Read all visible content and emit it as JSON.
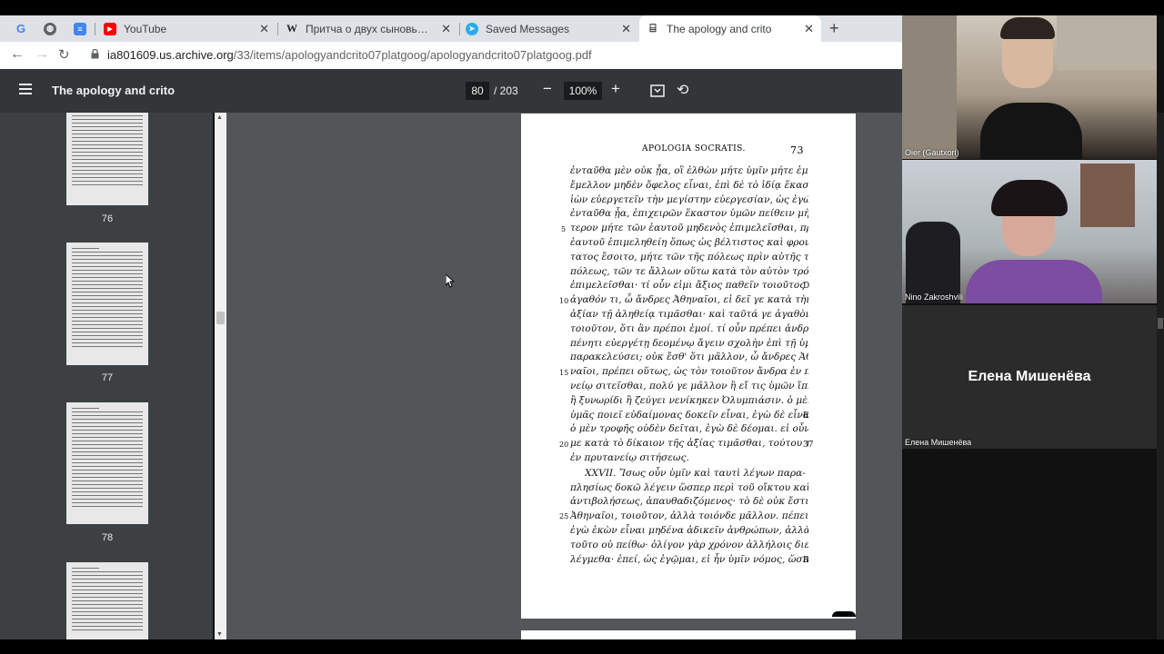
{
  "browser": {
    "tabs": [
      {
        "title": "",
        "icon": "google-icon"
      },
      {
        "title": "",
        "icon": "globe-icon"
      },
      {
        "title": "",
        "icon": "docs-icon"
      },
      {
        "title": "YouTube",
        "icon": "youtube-icon"
      },
      {
        "title": "Притча о двух сыновьях — Ви...",
        "icon": "wikipedia-icon"
      },
      {
        "title": "Saved Messages",
        "icon": "telegram-icon"
      },
      {
        "title": "The apology and crito",
        "icon": "archive-icon"
      }
    ],
    "url_host": "ia801609.us.archive.org",
    "url_path": "/33/items/apologyandcrito07platgoog/apologyandcrito07platgoog.pdf"
  },
  "pdf_toolbar": {
    "title": "The apology and crito",
    "current_page": "80",
    "total_pages": "/ 203",
    "zoom": "100%"
  },
  "thumbnails": [
    {
      "page": "76"
    },
    {
      "page": "77"
    },
    {
      "page": "78"
    }
  ],
  "document_page": {
    "running_head": "APOLOGIA SOCRATIS.",
    "page_number": "73",
    "lines": [
      "ἐνταῦθα μὲν οὐκ ᾖα, οἳ ἐλθὼν μήτε ὑμῖν μήτε ἐμαυτῷ",
      "ἔμελλον μηδὲν ὄφελος εἶναι, ἐπὶ δὲ τὸ ἰδίᾳ ἕκαστον",
      "ἰὼν εὐεργετεῖν τὴν μεγίστην εὐεργεσίαν, ὡς ἐγώ φημι,",
      "ἐνταῦθα ᾖα, ἐπιχειρῶν ἕκαστον ὑμῶν πείθειν μὴ πρό-",
      "τερον μήτε τῶν ἑαυτοῦ μηδενὸς ἐπιμελεῖσθαι, πρὶν",
      "ἑαυτοῦ ἐπιμεληθείη ὅπως ὡς βέλτιστος καὶ φρονιμώ-",
      "τατος ἔσοιτο, μήτε τῶν τῆς πόλεως πρὶν αὐτῆς τῆς",
      "πόλεως, τῶν τε ἄλλων οὕτω κατὰ τὸν αὐτὸν τρόπον",
      "ἐπιμελεῖσθαι· τί οὖν εἰμι ἄξιος παθεῖν τοιοῦτος ὤν;",
      "ἀγαθόν τι, ὦ ἄνδρες Ἀθηναῖοι, εἰ δεῖ γε κατὰ τὴν",
      "ἀξίαν τῇ ἀληθείᾳ τιμᾶσθαι· καὶ ταῦτά γε ἀγαθὸν",
      "τοιοῦτον, ὅτι ἂν πρέποι ἐμοί. τί οὖν πρέπει ἀνδρὶ",
      "πένητι εὐεργέτῃ δεομένῳ ἄγειν σχολὴν ἐπὶ τῇ ὑμετέρᾳ",
      "παρακελεύσει; οὐκ ἔσθ' ὅτι μᾶλλον, ὦ ἄνδρες Ἀθη-",
      "ναῖοι, πρέπει οὕτως, ὡς τὸν τοιοῦτον ἄνδρα ἐν πρυτα-",
      "νείῳ σιτεῖσθαι, πολύ γε μᾶλλον ἢ εἴ τις ὑμῶν ἵππῳ",
      "ἢ ξυνωρίδι ἢ ζεύγει νενίκηκεν Ὀλυμπιάσιν. ὁ μὲν γὰρ",
      "ὑμᾶς ποιεῖ εὐδαίμονας δοκεῖν εἶναι, ἐγὼ δὲ εἶναι· καὶ",
      "ὁ μὲν τροφῆς οὐδὲν δεῖται, ἐγὼ δὲ δέομαι. εἰ οὖν δεῖ",
      "με κατὰ τὸ δίκαιον τῆς ἀξίας τιμᾶσθαι, τούτου τιμῶμαι,",
      "ἐν πρυτανείῳ σιτήσεως.",
      "XXVII. Ἴσως οὖν ὑμῖν καὶ ταυτὶ λέγων παρα-",
      "πλησίως δοκῶ λέγειν ὥσπερ περὶ τοῦ οἴκτου καὶ τῆς",
      "ἀντιβολήσεως, ἀπαυθαδιζόμενος· τὸ δὲ οὐκ ἔστιν, ὦ",
      "Ἀθηναῖοι, τοιοῦτον, ἀλλὰ τοιόνδε μᾶλλον. πέπεισμαι",
      "ἐγὼ ἑκὼν εἶναι μηδένα ἀδικεῖν ἀνθρώπων, ἀλλὰ ὑμᾶς",
      "τοῦτο οὐ πείθω· ὀλίγον γὰρ χρόνον ἀλλήλοις διει-",
      "λέγμεθα· ἐπεί, ὡς ἐγῷμαι, εἰ ἦν ὑμῖν νόμος, ὥσπερ καὶ"
    ],
    "line_numbers": [
      "5",
      "10",
      "15",
      "20",
      "25"
    ],
    "margin_notes": [
      "D",
      "E",
      "37",
      "B"
    ]
  },
  "video_call": {
    "participants": [
      {
        "name": "Oier (Gautxori)"
      },
      {
        "name": "Nino Zakroshvili"
      },
      {
        "name": "Елена Мишенёва",
        "display_name": "Елена Мишенёва"
      }
    ]
  }
}
